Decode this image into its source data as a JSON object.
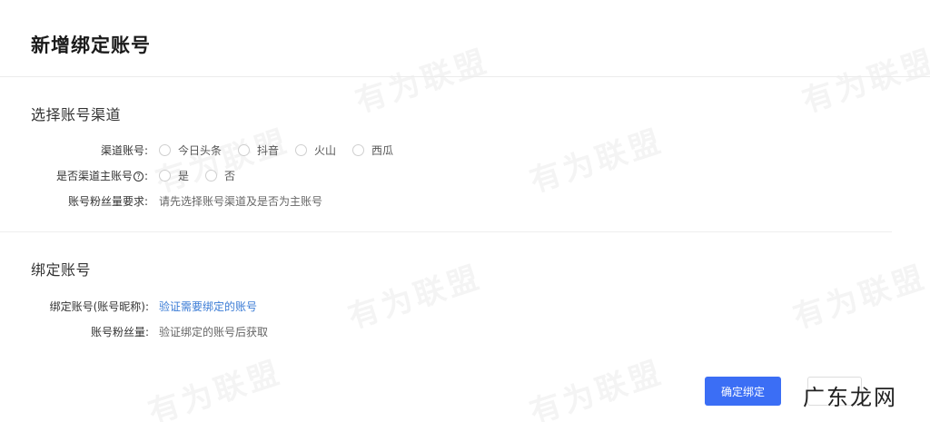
{
  "page": {
    "title": "新增绑定账号"
  },
  "section1": {
    "heading": "选择账号渠道",
    "channel_label": "渠道账号:",
    "channels": [
      "今日头条",
      "抖音",
      "火山",
      "西瓜"
    ],
    "main_account_label_prefix": "是否渠道主账号",
    "main_account_label_suffix": ":",
    "main_account_options": [
      "是",
      "否"
    ],
    "fans_req_label": "账号粉丝量要求:",
    "fans_req_value": "请先选择账号渠道及是否为主账号"
  },
  "section2": {
    "heading": "绑定账号",
    "bind_label": "绑定账号(账号昵称):",
    "bind_link": "验证需要绑定的账号",
    "fans_label": "账号粉丝量:",
    "fans_value": "验证绑定的账号后获取"
  },
  "actions": {
    "confirm_label": "确定绑定"
  },
  "watermark": {
    "text": "有为联盟"
  },
  "overlay": {
    "logo_text": "广东龙网"
  },
  "colors": {
    "primary": "#3b6ef5",
    "link": "#3a7bd5"
  }
}
